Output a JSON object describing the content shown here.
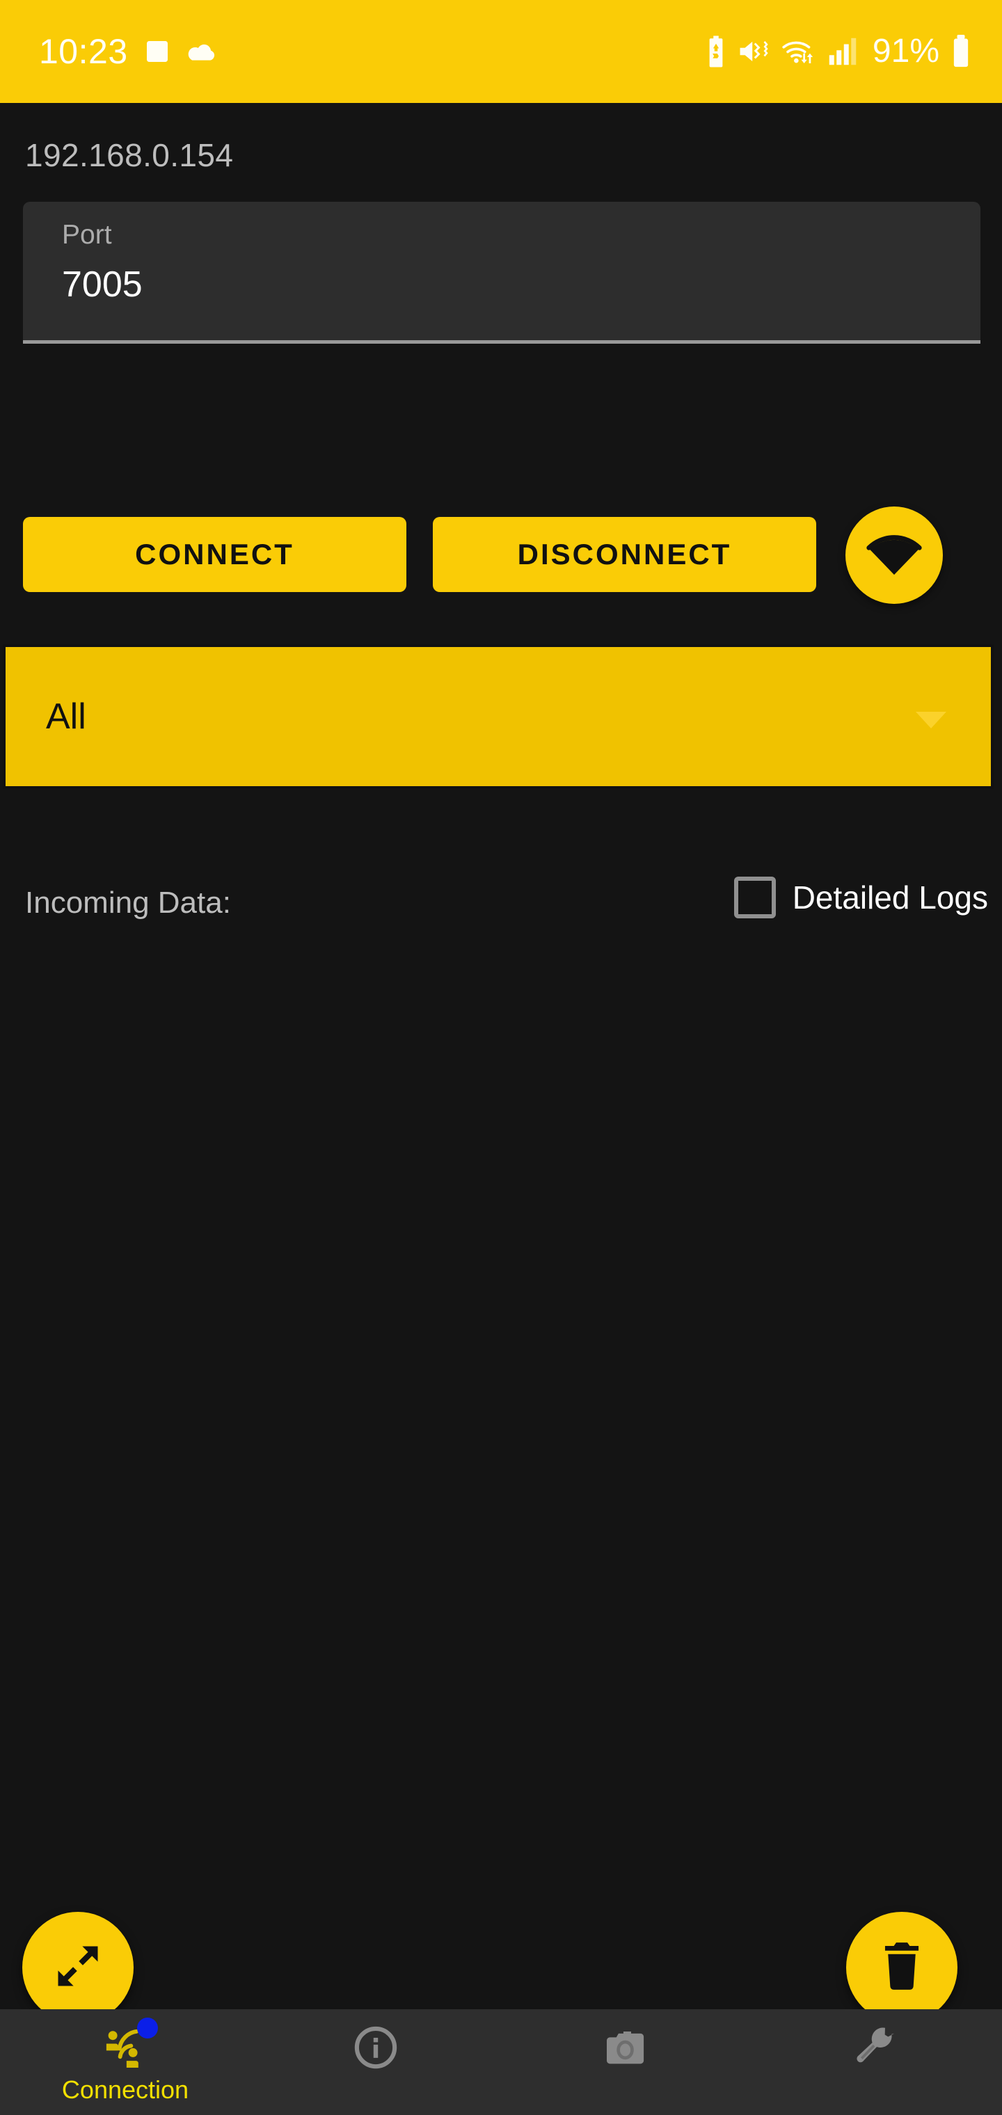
{
  "status_bar": {
    "time": "10:23",
    "battery_percent": "91%",
    "background_color": "#FACC06",
    "foreground_color": "#FFFEF5",
    "left_icons": [
      "gallery-image-icon",
      "cloud-icon"
    ],
    "right_icons": [
      "battery-saver-icon",
      "mute-vibrate-icon",
      "wifi-transfer-icon",
      "cellular-signal-icon",
      "battery-icon"
    ]
  },
  "connection": {
    "ip_address": "192.168.0.154",
    "port_field": {
      "label": "Port",
      "value": "7005",
      "placeholder": "Port"
    },
    "connect_label": "CONNECT",
    "disconnect_label": "DISCONNECT",
    "wifi_fab_icon": "wifi-icon",
    "filter_spinner": {
      "value": "All",
      "options": [
        "All"
      ]
    }
  },
  "log_panel": {
    "title": "Incoming Data:",
    "detailed_logs_label": "Detailed Logs",
    "detailed_logs_checked": false,
    "log_text": "",
    "expand_fab_icon": "expand-arrows-icon",
    "clear_fab_icon": "trash-delete-icon"
  },
  "bottom_nav": {
    "items": [
      {
        "label": "Connection",
        "icon": "connection-people-icon",
        "active": true,
        "badge": true
      },
      {
        "label": "",
        "icon": "info-icon",
        "active": false,
        "badge": false
      },
      {
        "label": "",
        "icon": "camera-icon",
        "active": false,
        "badge": false
      },
      {
        "label": "",
        "icon": "wrench-tools-icon",
        "active": false,
        "badge": false
      }
    ]
  },
  "colors": {
    "accent_yellow": "#FACC06",
    "spinner_yellow": "#F0C200",
    "nav_active_yellow": "#F3E000",
    "badge_blue": "#0B1FE8",
    "background": "#141414",
    "nav_background": "#2E2E2E",
    "field_background": "#2D2D2D",
    "inactive_gray": "#8A8A8A"
  }
}
